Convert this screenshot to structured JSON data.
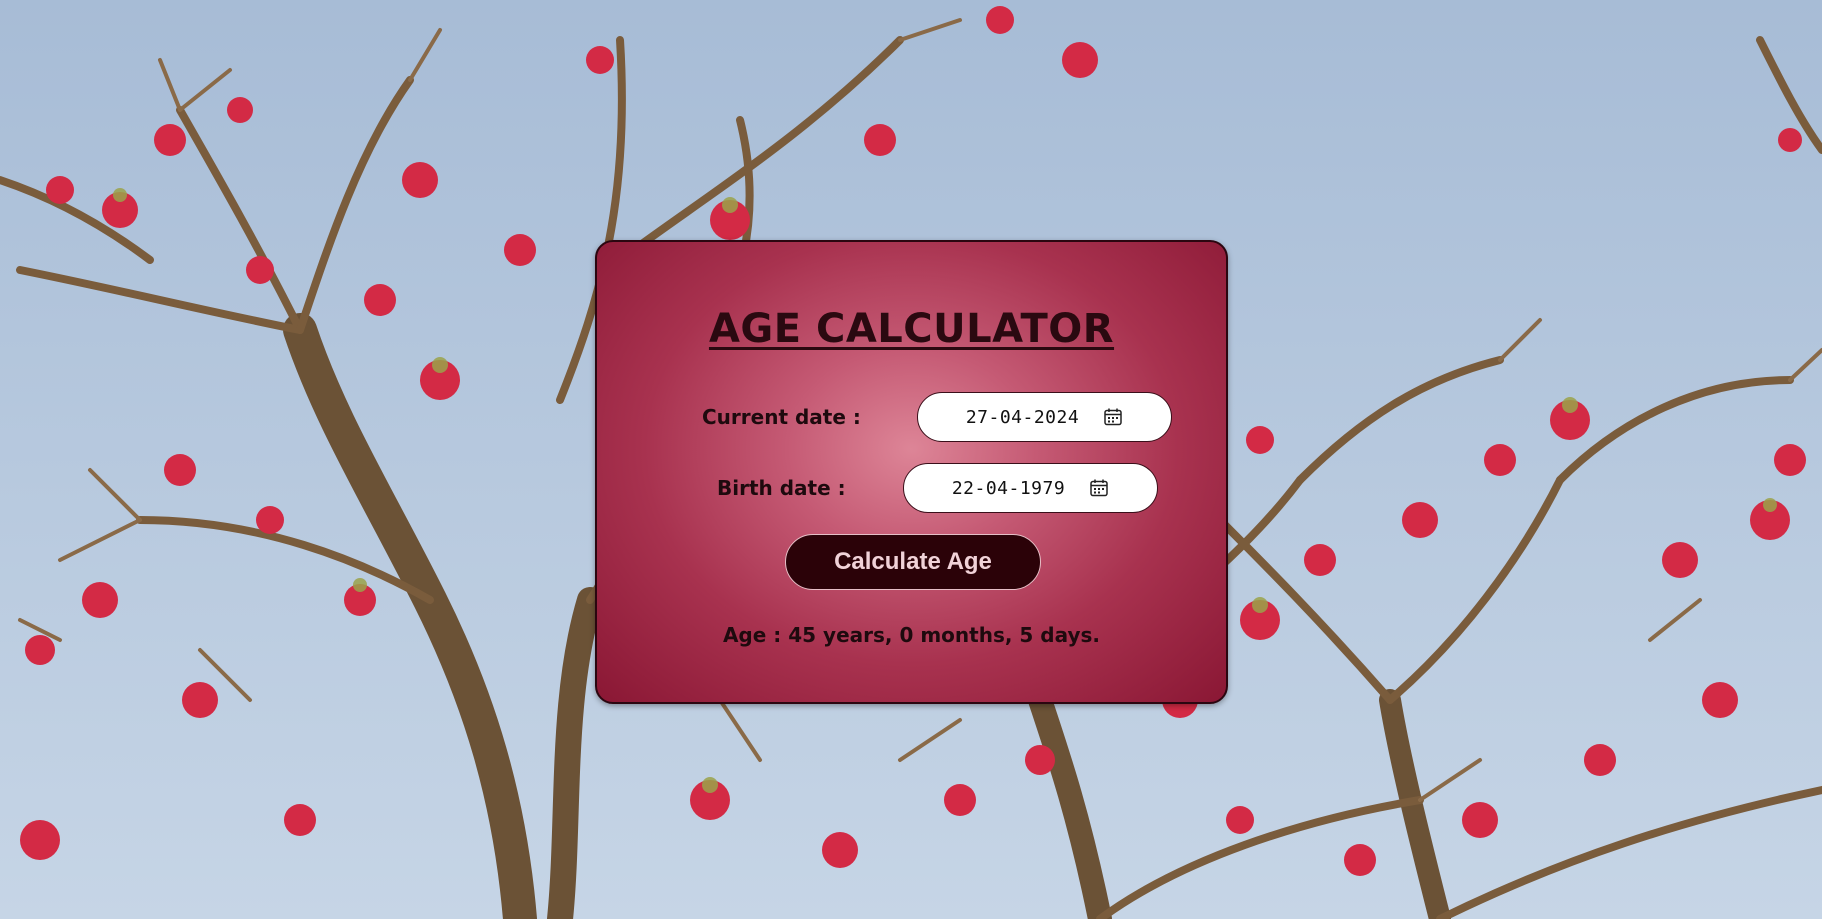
{
  "page": {
    "title": "AGE CALCULATOR"
  },
  "form": {
    "current_date_label": "Current date :",
    "current_date_value": "27-04-2024",
    "birth_date_label": "Birth date :",
    "birth_date_value": "22-04-1979",
    "calculate_button_label": "Calculate Age"
  },
  "result": {
    "text": "Age : 45 years, 0 months, 5 days."
  },
  "icons": {
    "date_picker": "calendar-icon"
  },
  "colors": {
    "card_center": "#dd8597",
    "card_edge": "#8a1734",
    "button_bg": "#2b0208",
    "button_text": "#f1d2d8",
    "text_dark": "#1e0a0e",
    "sky": "#b6c8de",
    "blossom": "#d8304a"
  }
}
